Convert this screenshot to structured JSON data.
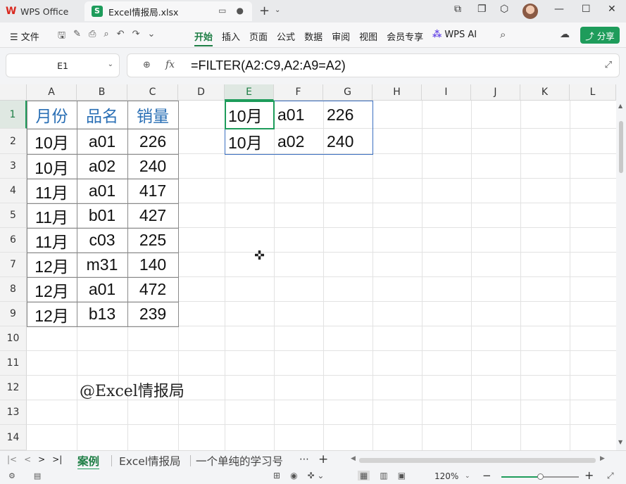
{
  "titlebar": {
    "app_tab": "WPS Office",
    "file_tab": "Excel情报局.xlsx",
    "file_tab_icon": "S"
  },
  "ribbon": {
    "file_menu": "☰ 文件",
    "tabs": [
      "开始",
      "插入",
      "页面",
      "公式",
      "数据",
      "审阅",
      "视图",
      "会员专享"
    ],
    "active_tab": "开始",
    "ai_label": "WPS AI",
    "share_label": "分享"
  },
  "formula_bar": {
    "name_box": "E1",
    "fx_label": "fx",
    "formula": "=FILTER(A2:C9,A2:A9=A2)"
  },
  "grid": {
    "columns": [
      "A",
      "B",
      "C",
      "D",
      "E",
      "F",
      "G",
      "H",
      "I",
      "J",
      "K",
      "L"
    ],
    "selected_column": "E",
    "rows": [
      "1",
      "2",
      "3",
      "4",
      "5",
      "6",
      "7",
      "8",
      "9",
      "10",
      "11",
      "12",
      "13",
      "14"
    ],
    "selected_row": "1",
    "source_table": {
      "headers": [
        "月份",
        "品名",
        "销量"
      ],
      "rows": [
        [
          "10月",
          "a01",
          "226"
        ],
        [
          "10月",
          "a02",
          "240"
        ],
        [
          "11月",
          "a01",
          "417"
        ],
        [
          "11月",
          "b01",
          "427"
        ],
        [
          "11月",
          "c03",
          "225"
        ],
        [
          "12月",
          "m31",
          "140"
        ],
        [
          "12月",
          "a01",
          "472"
        ],
        [
          "12月",
          "b13",
          "239"
        ]
      ]
    },
    "result_table": {
      "rows": [
        [
          "10月",
          "a01",
          "226"
        ],
        [
          "10月",
          "a02",
          "240"
        ]
      ]
    },
    "watermark": "@Excel情报局"
  },
  "sheets": {
    "tabs": [
      "案例",
      "Excel情报局",
      "一个单纯的学习号"
    ],
    "active": "案例",
    "more": "⋯"
  },
  "status": {
    "zoom": "120%",
    "zoom_fraction": 0.5
  },
  "colors": {
    "accent": "#1e9c5b",
    "header_text": "#2a6fb5",
    "spill_border": "#3b6fc0"
  }
}
